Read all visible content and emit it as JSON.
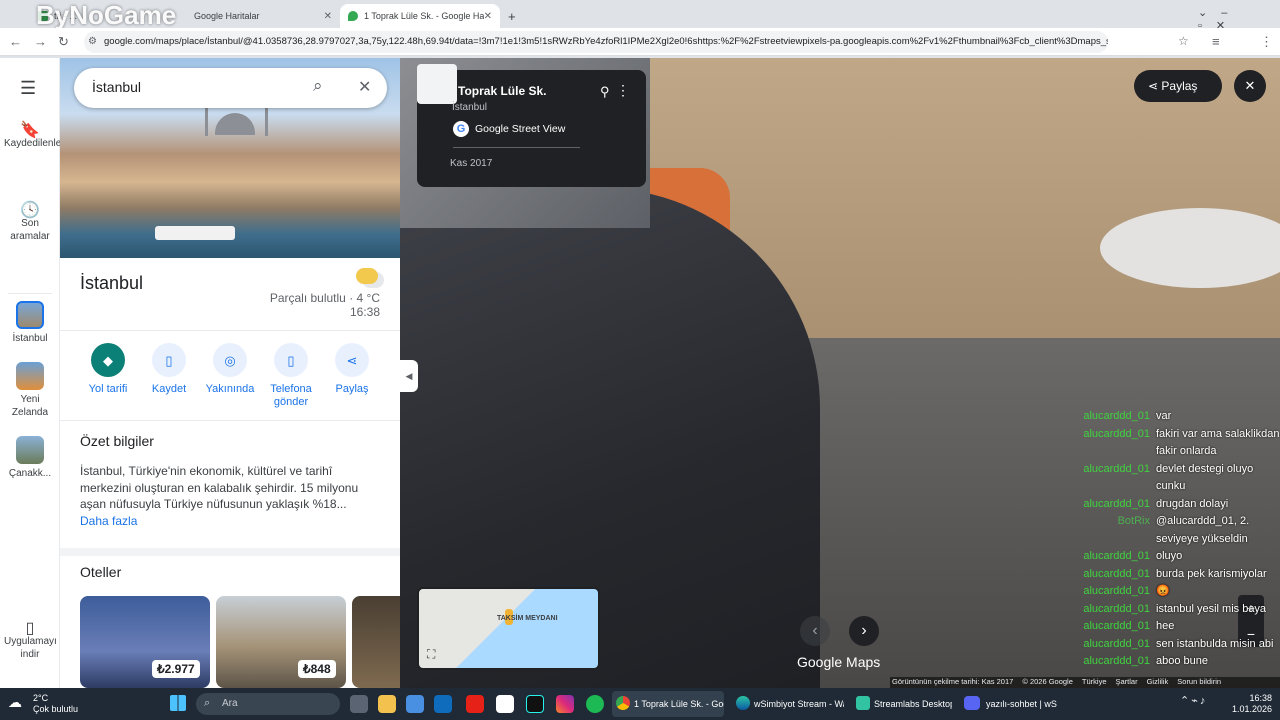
{
  "browser": {
    "tabs": [
      {
        "label": "tri - ..."
      },
      {
        "label": "Google Haritalar"
      },
      {
        "label": "1 Toprak Lüle Sk. - Google Harita"
      }
    ],
    "new_tab": "+",
    "url": "google.com/maps/place/İstanbul/@41.0358736,28.9797027,3a,75y,122.48h,69.94t/data=!3m7!1e1!3m5!1sRWzRbYe4zfoRl1IPMe2Xgl2e0!6shttps:%2F%2Fstreetviewpixels-pa.googleapis.com%2Fv1%2Fthumbnail%3Fcb_client%3Dmaps_sv.tactil..."
  },
  "watermark": "ByNoGame",
  "rail": {
    "items": [
      {
        "label": "Kaydedilenler"
      },
      {
        "label": "Son aramalar"
      },
      {
        "label": "İstanbul"
      },
      {
        "label": "Yeni Zelanda"
      },
      {
        "label": "Çanakk..."
      },
      {
        "label": "Uygulamayı indir"
      }
    ]
  },
  "search": {
    "value": "İstanbul"
  },
  "place": {
    "name": "İstanbul",
    "weather": "Parçalı bulutlu · 4 °C",
    "time": "16:38",
    "actions": [
      {
        "label": "Yol tarifi"
      },
      {
        "label": "Kaydet"
      },
      {
        "label": "Yakınında"
      },
      {
        "label": "Telefona gönder"
      },
      {
        "label": "Paylaş"
      }
    ],
    "summary_title": "Özet bilgiler",
    "summary": "İstanbul, Türkiye'nin ekonomik, kültürel ve tarihî merkezini oluşturan en kalabalık şehirdir. 15 milyonu aşan nüfusuyla Türkiye nüfusunun yaklaşık %18...",
    "more": "Daha fazla",
    "hotels_title": "Oteller",
    "hotels": [
      {
        "price": "₺2.977"
      },
      {
        "price": "₺848"
      }
    ]
  },
  "streetview": {
    "street": "Toprak Lüle Sk.",
    "city": "İstanbul",
    "source": "Google Street View",
    "date": "Kas 2017",
    "share": "Paylaş",
    "minimap_label": "TAKSİM MEYDANI",
    "brand": "Google Maps",
    "footer": [
      "Görüntünün çekilme tarihi: Kas 2017",
      "© 2026 Google",
      "Türkiye",
      "Şartlar",
      "Gizlilik",
      "Sorun bildirin"
    ]
  },
  "chat": [
    {
      "user": "alucarddd_01",
      "msg": "var"
    },
    {
      "user": "alucarddd_01",
      "msg": "fakiri var ama salaklikdan fakir onlarda"
    },
    {
      "user": "alucarddd_01",
      "msg": "devlet destegi oluyo cunku"
    },
    {
      "user": "alucarddd_01",
      "msg": "drugdan dolayi"
    },
    {
      "user": "BotRix",
      "msg": "@alucarddd_01, 2. seviyeye yükseldin"
    },
    {
      "user": "alucarddd_01",
      "msg": "oluyo"
    },
    {
      "user": "alucarddd_01",
      "msg": "burda pek karismiyolar"
    },
    {
      "user": "alucarddd_01",
      "msg": "😡"
    },
    {
      "user": "alucarddd_01",
      "msg": "istanbul yesil mis baya"
    },
    {
      "user": "alucarddd_01",
      "msg": "hee"
    },
    {
      "user": "alucarddd_01",
      "msg": "sen istanbulda misin abi"
    },
    {
      "user": "alucarddd_01",
      "msg": "aboo bune"
    }
  ],
  "taskbar": {
    "weather_temp": "2°C",
    "weather_text": "Çok bulutlu",
    "search": "Ara",
    "apps": [
      {
        "label": "1 Toprak Lüle Sk. - Goog"
      },
      {
        "label": "wSimbiyot Stream - War"
      },
      {
        "label": "Streamlabs Desktop"
      },
      {
        "label": "yazılı-sohbet | wS"
      }
    ],
    "time": "16:38",
    "date": "1.01.2026"
  },
  "colors": {
    "accent": "#1a73e8",
    "teal": "#0b8077",
    "chat_user": "#3fd33f"
  }
}
